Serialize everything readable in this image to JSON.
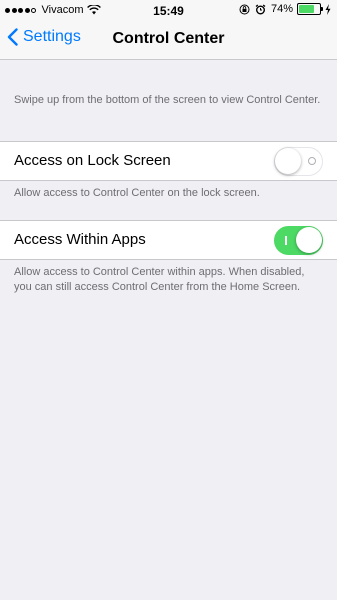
{
  "status_bar": {
    "carrier": "Vivacom",
    "time": "15:49",
    "battery_percent": "74%",
    "battery_level": 0.74,
    "signal_bars_filled": 4,
    "signal_bars_total": 5
  },
  "nav": {
    "back_label": "Settings",
    "title": "Control Center"
  },
  "intro_footer": "Swipe up from the bottom of the screen to view Control Center.",
  "settings": [
    {
      "label": "Access on Lock Screen",
      "enabled": false,
      "footer": "Allow access to Control Center on the lock screen."
    },
    {
      "label": "Access Within Apps",
      "enabled": true,
      "footer": "Allow access to Control Center within apps. When disabled, you can still access Control Center from the Home Screen."
    }
  ],
  "colors": {
    "accent": "#007aff",
    "toggle_on": "#4cd964",
    "background": "#efeff4",
    "footer_text": "#6d6d72"
  }
}
